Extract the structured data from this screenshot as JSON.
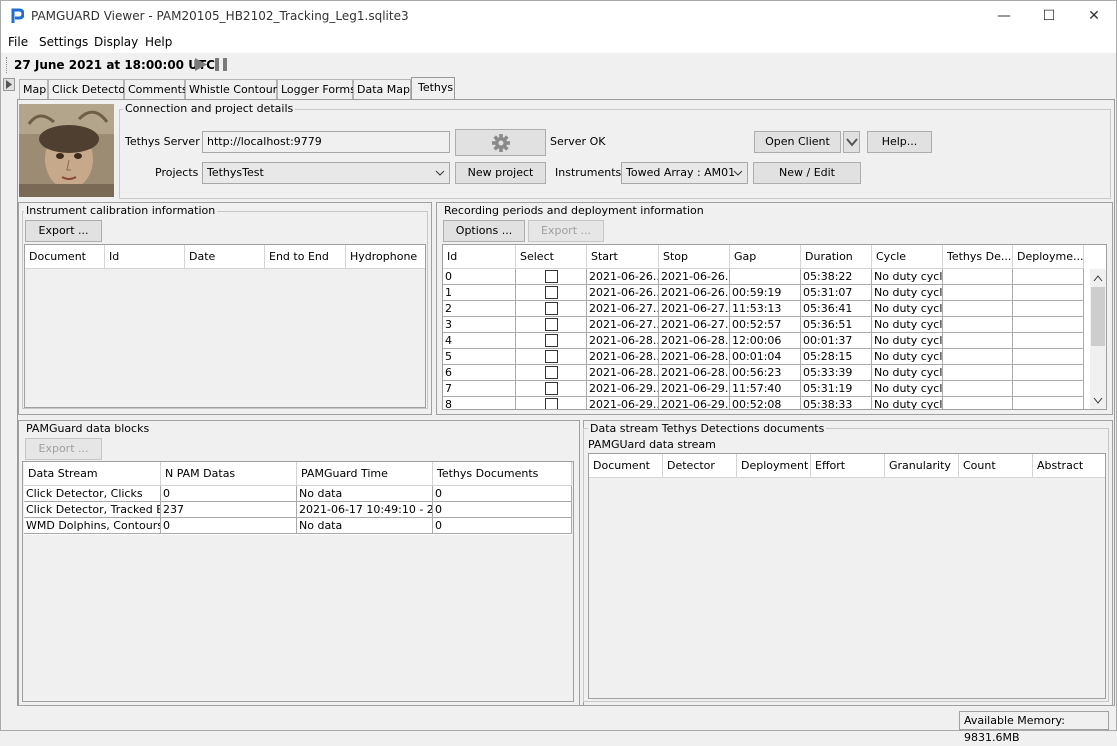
{
  "window": {
    "title": "PAMGUARD Viewer - PAM20105_HB2102_Tracking_Leg1.sqlite3",
    "controls": {
      "minimize": "—",
      "maximize": "☐",
      "close": "✕"
    }
  },
  "menu": [
    "File",
    "Settings",
    "Display",
    "Help"
  ],
  "toolbar": {
    "datetime": "27 June 2021 at 18:00:00 UTC"
  },
  "tabs": [
    "Map",
    "Click Detector",
    "Comments",
    "Whistle Contours",
    "Logger Forms",
    "Data Map",
    "Tethys"
  ],
  "active_tab": "Tethys",
  "connection": {
    "title": "Connection and project details",
    "server_label": "Tethys Server",
    "server_value": "http://localhost:9779",
    "server_status": "Server OK",
    "open_client": "Open Client",
    "help": "Help...",
    "projects_label": "Projects",
    "project_value": "TethysTest",
    "new_project": "New project",
    "instruments_label": "Instruments",
    "instrument_value": "Towed Array : AM01",
    "new_edit": "New / Edit"
  },
  "calibration": {
    "title": "Instrument calibration information",
    "export": "Export ...",
    "columns": [
      "Document",
      "Id",
      "Date",
      "End to End",
      "Hydrophone"
    ]
  },
  "recording": {
    "title": "Recording periods and deployment information",
    "options": "Options ...",
    "export": "Export ...",
    "columns": [
      "Id",
      "Select",
      "Start",
      "Stop",
      "Gap",
      "Duration",
      "Cycle",
      "Tethys De...",
      "Deployme..."
    ],
    "rows": [
      [
        "0",
        "",
        "2021-06-26...",
        "2021-06-26...",
        "",
        "05:38:22",
        "No duty cycle",
        "",
        ""
      ],
      [
        "1",
        "",
        "2021-06-26...",
        "2021-06-26...",
        "00:59:19",
        "05:31:07",
        "No duty cycle",
        "",
        ""
      ],
      [
        "2",
        "",
        "2021-06-27...",
        "2021-06-27...",
        "11:53:13",
        "05:36:41",
        "No duty cycle",
        "",
        ""
      ],
      [
        "3",
        "",
        "2021-06-27...",
        "2021-06-27...",
        "00:52:57",
        "05:36:51",
        "No duty cycle",
        "",
        ""
      ],
      [
        "4",
        "",
        "2021-06-28...",
        "2021-06-28...",
        "12:00:06",
        "00:01:37",
        "No duty cycle",
        "",
        ""
      ],
      [
        "5",
        "",
        "2021-06-28...",
        "2021-06-28...",
        "00:01:04",
        "05:28:15",
        "No duty cycle",
        "",
        ""
      ],
      [
        "6",
        "",
        "2021-06-28...",
        "2021-06-28...",
        "00:56:23",
        "05:33:39",
        "No duty cycle",
        "",
        ""
      ],
      [
        "7",
        "",
        "2021-06-29...",
        "2021-06-29...",
        "11:57:40",
        "05:31:19",
        "No duty cycle",
        "",
        ""
      ],
      [
        "8",
        "",
        "2021-06-29...",
        "2021-06-29...",
        "00:52:08",
        "05:38:33",
        "No duty cycle",
        "",
        ""
      ]
    ]
  },
  "datablocks": {
    "title": "PAMGuard data blocks",
    "export": "Export ...",
    "columns": [
      "Data Stream",
      "N PAM Datas",
      "PAMGuard Time",
      "Tethys Documents"
    ],
    "rows": [
      [
        "Click Detector, Clicks",
        "0",
        "No data",
        "0"
      ],
      [
        "Click Detector, Tracked E...",
        "237",
        "2021-06-17 10:49:10 - 2...",
        "0"
      ],
      [
        "WMD Dolphins, Contours",
        "0",
        "No data",
        "0"
      ]
    ]
  },
  "detections": {
    "title": "Data stream Tethys Detections documents",
    "subtitle": "PAMGUard data stream",
    "columns": [
      "Document",
      "Detector",
      "Deployment",
      "Effort",
      "Granularity",
      "Count",
      "Abstract"
    ]
  },
  "status": {
    "memory": "Available Memory: 9831.6MB"
  },
  "colors": {
    "accent": "#1e6fd0",
    "play": "#7a7a7a"
  }
}
